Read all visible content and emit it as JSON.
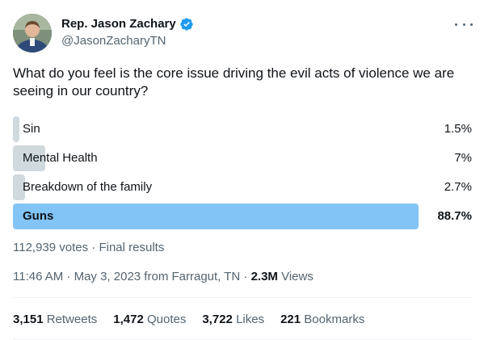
{
  "author": {
    "display_name": "Rep. Jason Zachary",
    "handle": "@JasonZacharyTN",
    "verified_color": "#1d9bf0"
  },
  "tweet": {
    "question": "What do you feel is the core issue driving the evil acts of violence we are seeing in our country?"
  },
  "poll": {
    "options": [
      {
        "label": "Sin",
        "percent_text": "1.5%",
        "percent": 1.5,
        "winner": false
      },
      {
        "label": "Mental Health",
        "percent_text": "7%",
        "percent": 7,
        "winner": false
      },
      {
        "label": "Breakdown of the family",
        "percent_text": "2.7%",
        "percent": 2.7,
        "winner": false
      },
      {
        "label": "Guns",
        "percent_text": "88.7%",
        "percent": 88.7,
        "winner": true
      }
    ],
    "votes_text": "112,939 votes · Final results",
    "bar_color": "#cfd9de",
    "winner_color": "#83c4f6"
  },
  "meta": {
    "time_date": "11:46 AM · May 3, 2023 from Farragut, TN · ",
    "views_count": "2.3M",
    "views_label": " Views"
  },
  "stats": {
    "retweets_count": "3,151",
    "retweets_label": "Retweets",
    "quotes_count": "1,472",
    "quotes_label": "Quotes",
    "likes_count": "3,722",
    "likes_label": "Likes",
    "bookmarks_count": "221",
    "bookmarks_label": "Bookmarks"
  }
}
